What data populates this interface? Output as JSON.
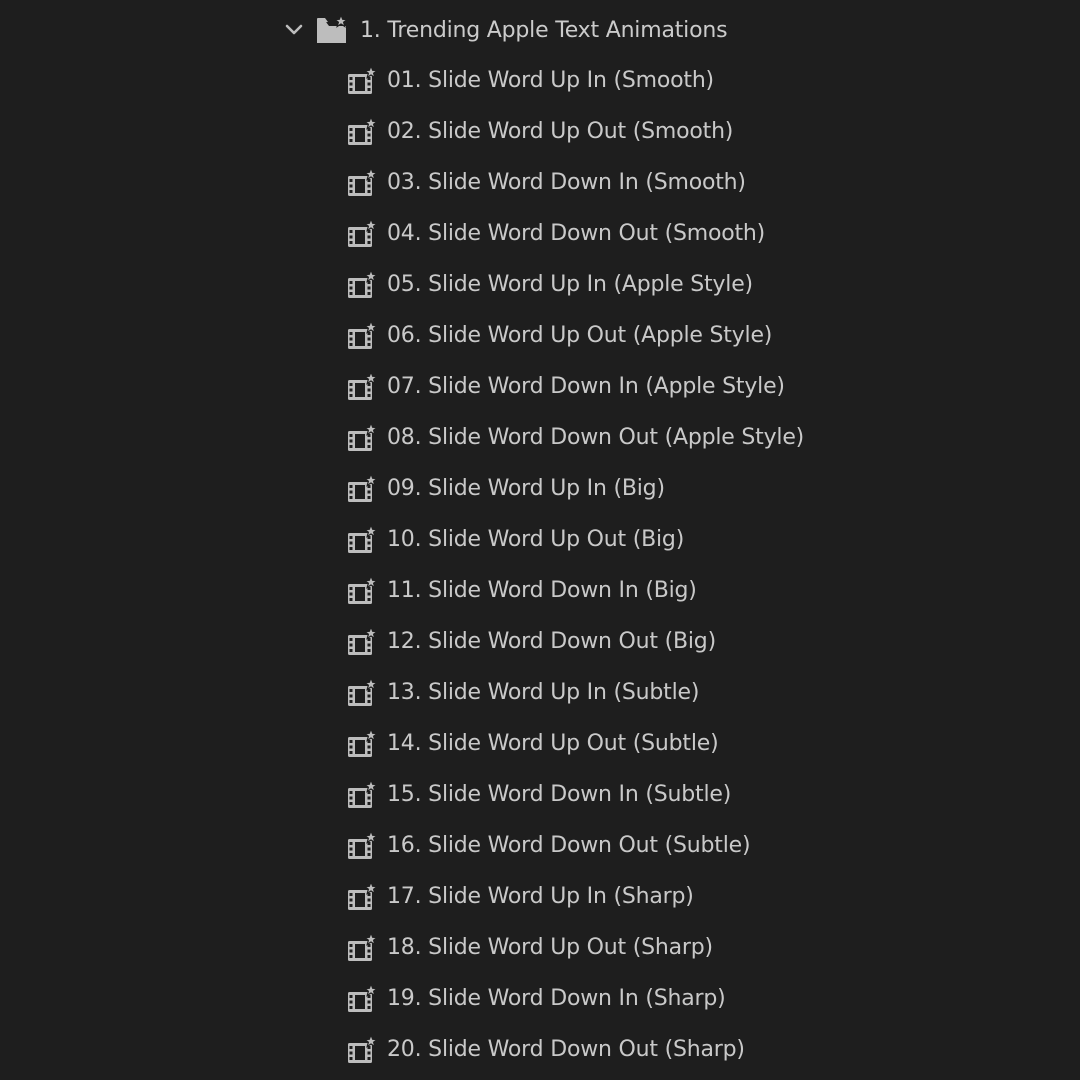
{
  "colors": {
    "background": "#1e1e1e",
    "text": "#c9c9c9",
    "icon": "#bdbdbd"
  },
  "tree": {
    "folder": {
      "label": "1. Trending Apple Text Animations",
      "expanded": true,
      "icon": "folder-star-icon",
      "toggle_icon": "chevron-down-icon"
    },
    "items_icon": "film-clip-star-icon",
    "items": [
      {
        "label": "01. Slide Word Up In (Smooth)"
      },
      {
        "label": "02. Slide Word Up Out (Smooth)"
      },
      {
        "label": "03. Slide Word Down In (Smooth)"
      },
      {
        "label": "04. Slide Word Down Out (Smooth)"
      },
      {
        "label": "05. Slide Word Up In (Apple Style)"
      },
      {
        "label": "06. Slide Word Up Out (Apple Style)"
      },
      {
        "label": "07. Slide Word Down In (Apple Style)"
      },
      {
        "label": "08. Slide Word Down Out (Apple Style)"
      },
      {
        "label": "09. Slide Word Up In (Big)"
      },
      {
        "label": "10. Slide Word Up Out (Big)"
      },
      {
        "label": "11. Slide Word Down In (Big)"
      },
      {
        "label": "12. Slide Word Down Out (Big)"
      },
      {
        "label": "13. Slide Word Up In (Subtle)"
      },
      {
        "label": "14. Slide Word Up Out (Subtle)"
      },
      {
        "label": "15. Slide Word Down In (Subtle)"
      },
      {
        "label": "16. Slide Word Down Out (Subtle)"
      },
      {
        "label": "17. Slide Word Up In (Sharp)"
      },
      {
        "label": "18. Slide Word Up Out (Sharp)"
      },
      {
        "label": "19. Slide Word Down In (Sharp)"
      },
      {
        "label": "20. Slide Word Down Out (Sharp)"
      }
    ]
  }
}
